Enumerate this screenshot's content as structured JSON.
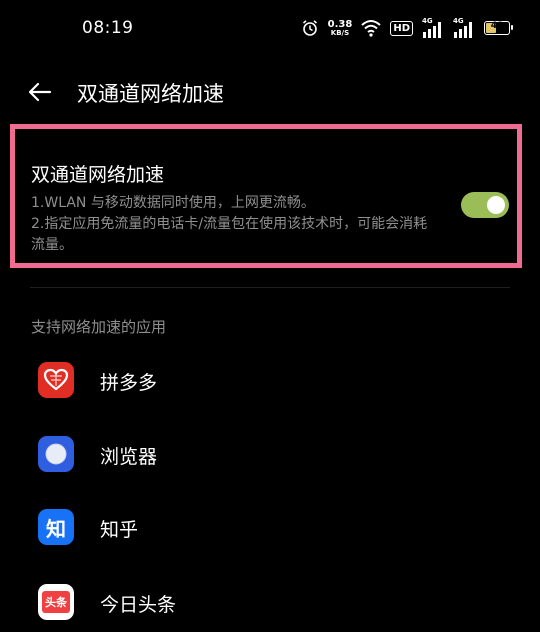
{
  "status_bar": {
    "time": "08:19",
    "net_speed_value": "0.38",
    "net_speed_unit": "KB/S",
    "hd_badge": "HD",
    "signal_1_tag": "4G",
    "signal_2_tag": "4G",
    "battery_level": "48",
    "battery_fraction": 0.48,
    "battery_color": "#e3c56a"
  },
  "header": {
    "back_icon": "arrow-left-icon",
    "title": "双通道网络加速"
  },
  "setting": {
    "title": "双通道网络加速",
    "desc_line_1": "1.WLAN 与移动数据同时使用，上网更流畅。",
    "desc_line_2": "2.指定应用免流量的电话卡/流量包在使用该技术时，可能会消耗流量。",
    "toggle_on": true,
    "toggle_color": "#9bbd57",
    "highlight_color": "#f06b92"
  },
  "section": {
    "title": "支持网络加速的应用"
  },
  "apps": [
    {
      "label": "拼多多",
      "icon": "pinduoduo-icon",
      "color": "#e02e24"
    },
    {
      "label": "浏览器",
      "icon": "browser-icon",
      "color": "#2f5fe0"
    },
    {
      "label": "知乎",
      "icon": "zhihu-icon",
      "icon_text": "知",
      "color": "#1772f6"
    },
    {
      "label": "今日头条",
      "icon": "toutiao-icon",
      "icon_text": "头条",
      "color": "#f04142"
    }
  ]
}
